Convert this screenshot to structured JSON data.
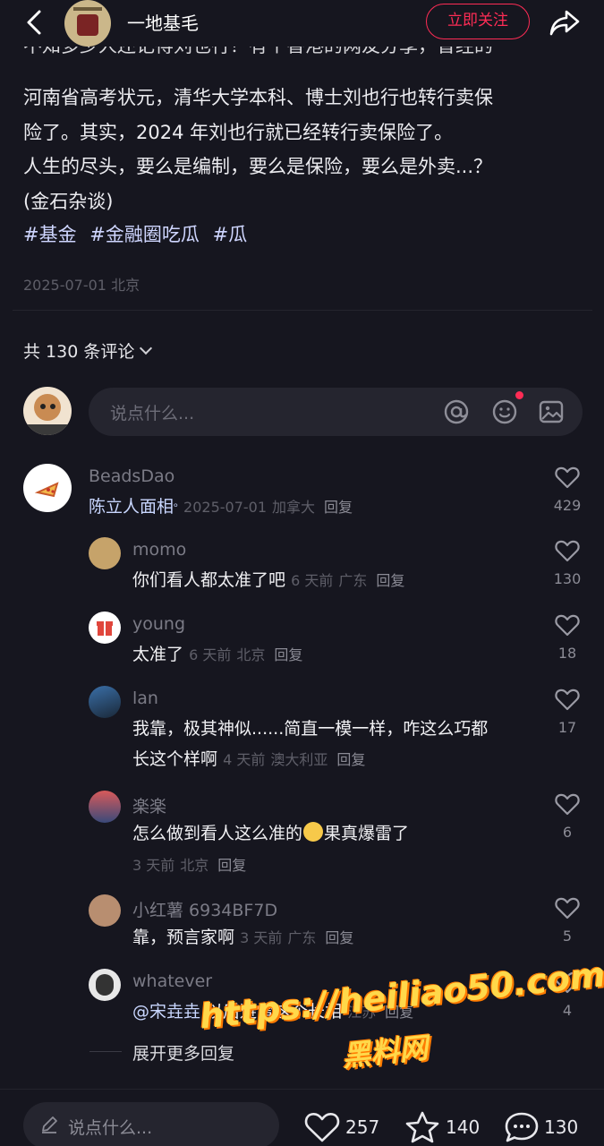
{
  "header": {
    "author_name": "一地基毛",
    "follow_label": "立即关注"
  },
  "post": {
    "clipped_line": "不知多少人还记得刘也行？有个香港的网友分享，曾经的",
    "line1": "河南省高考状元，清华大学本科、博士刘也行也转行卖保",
    "line2": "险了。其实，2024 年刘也行就已经转行卖保险了。",
    "line3": "人生的尽头，要么是编制，要么是保险，要么是外卖...？",
    "line4": "(金石杂谈)",
    "tags": [
      "#基金",
      "#金融圈吃瓜",
      "#瓜"
    ],
    "date": "2025-07-01",
    "location": "北京"
  },
  "comments_header": {
    "label": "共 130 条评论"
  },
  "comment_input": {
    "placeholder": "说点什么..."
  },
  "comments": [
    {
      "name": "BeadsDao",
      "text": "陈立人面相",
      "time": "2025-07-01",
      "location": "加拿大",
      "reply": "回复",
      "likes": "429"
    },
    {
      "name": "momo",
      "text": "你们看人都太准了吧",
      "time": "6 天前",
      "location": "广东",
      "reply": "回复",
      "likes": "130"
    },
    {
      "name": "young",
      "text": "太准了",
      "time": "6 天前",
      "location": "北京",
      "reply": "回复",
      "likes": "18"
    },
    {
      "name": "lan",
      "text": "我靠，极其神似......简直一模一样，咋这么巧都",
      "text2": "长这个样啊",
      "time": "4 天前",
      "location": "澳大利亚",
      "reply": "回复",
      "likes": "17"
    },
    {
      "name": "楽楽",
      "text": "怎么做到看人这么准的",
      "text_after_emoji": "果真爆雷了",
      "time": "3 天前",
      "location": "北京",
      "reply": "回复",
      "likes": "6"
    },
    {
      "name": "小红薯 6934BF7D",
      "text": "靠，预言家啊",
      "time": "3 天前",
      "location": "广东",
      "reply": "回复",
      "likes": "5"
    },
    {
      "name": "whatever",
      "mention": "@宋垚垚",
      "text": " 以后避雷这个长相",
      "time": "",
      "location": "江苏",
      "reply": "回复",
      "likes": "4"
    }
  ],
  "expand_label": "展开更多回复",
  "watermark": {
    "url": "https://heiliao50.com",
    "name": "黑料网"
  },
  "bottom_bar": {
    "placeholder": "说点什么...",
    "likes": "257",
    "stars": "140",
    "comments": "130"
  },
  "colors": {
    "background": "#16161f",
    "accent": "#fe2c55",
    "tag": "#cfd6ff"
  }
}
